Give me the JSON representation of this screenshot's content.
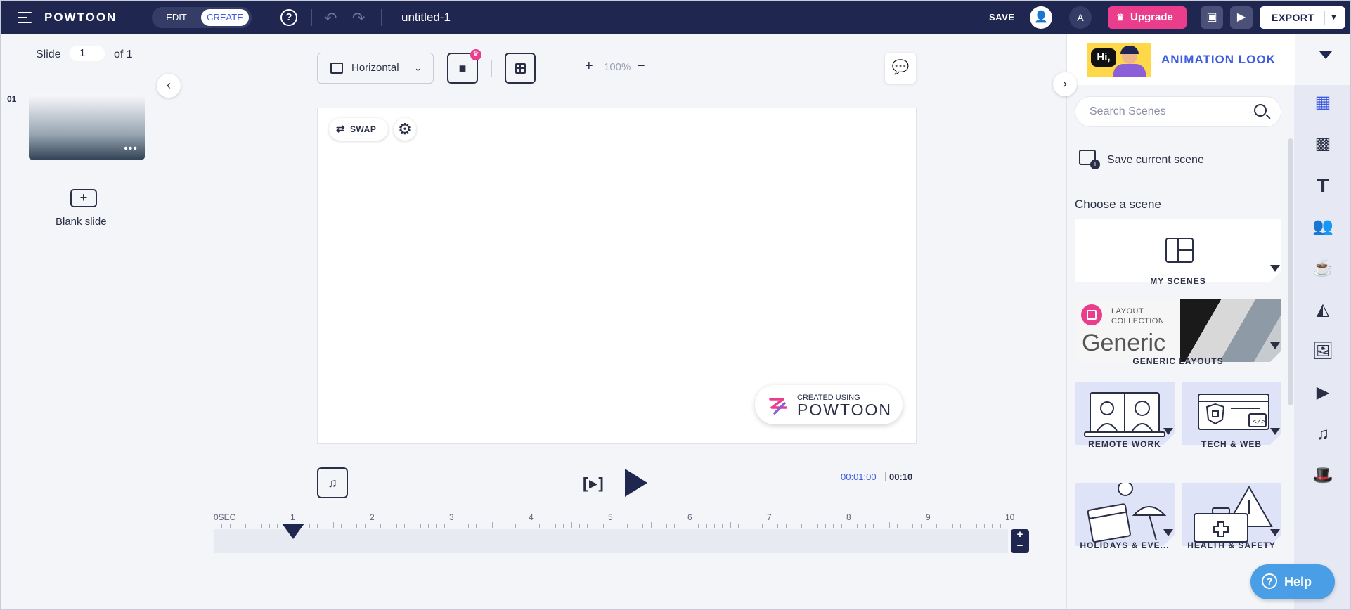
{
  "topbar": {
    "logo": "POWTOON",
    "mode_edit": "EDIT",
    "mode_create": "CREATE",
    "help_glyph": "?",
    "title": "untitled-1",
    "save": "SAVE",
    "avatar_initial": "A",
    "upgrade": "Upgrade",
    "export": "EXPORT"
  },
  "slides": {
    "label": "Slide",
    "current": "1",
    "of": "of 1",
    "items": [
      {
        "index": "01"
      }
    ],
    "blank_label": "Blank slide"
  },
  "stage": {
    "aspect": "Horizontal",
    "zoom": "100%",
    "swap_label": "SWAP",
    "watermark_small": "CREATED USING",
    "watermark_big": "POWTOON"
  },
  "playback": {
    "preview_glyph": "[▸]",
    "time_current": "00:01:00",
    "time_separator": "|",
    "time_total": "00:10"
  },
  "timeline": {
    "ticks": [
      "0SEC",
      "1",
      "2",
      "3",
      "4",
      "5",
      "6",
      "7",
      "8",
      "9",
      "10"
    ],
    "playhead_sec": 1
  },
  "right_panel": {
    "look_thumb_text": "Hi,",
    "look_title": "ANIMATION LOOK",
    "search_placeholder": "Search Scenes",
    "save_scene": "Save current scene",
    "choose_label": "Choose a scene",
    "scenes": [
      {
        "name": "MY SCENES"
      },
      {
        "name": "GENERIC LAYOUTS",
        "badge_line1": "LAYOUT",
        "badge_line2": "COLLECTION",
        "word": "Generic"
      },
      {
        "name": "REMOTE WORK"
      },
      {
        "name": "TECH & WEB"
      },
      {
        "name": "HOLIDAYS & EVE..."
      },
      {
        "name": "HEALTH & SAFETY"
      }
    ]
  },
  "rail_icons": [
    "layout-icon",
    "pattern-icon",
    "text-icon",
    "characters-icon",
    "props-icon",
    "shapes-icon",
    "image-icon",
    "video-icon",
    "music-icon",
    "magic-hat-icon"
  ],
  "help_button": "Help",
  "colors": {
    "topbar_bg": "#1f2650",
    "accent_blue": "#3d5ce0",
    "upgrade_pink": "#ea3e8c",
    "help_blue": "#4a9ee6"
  }
}
